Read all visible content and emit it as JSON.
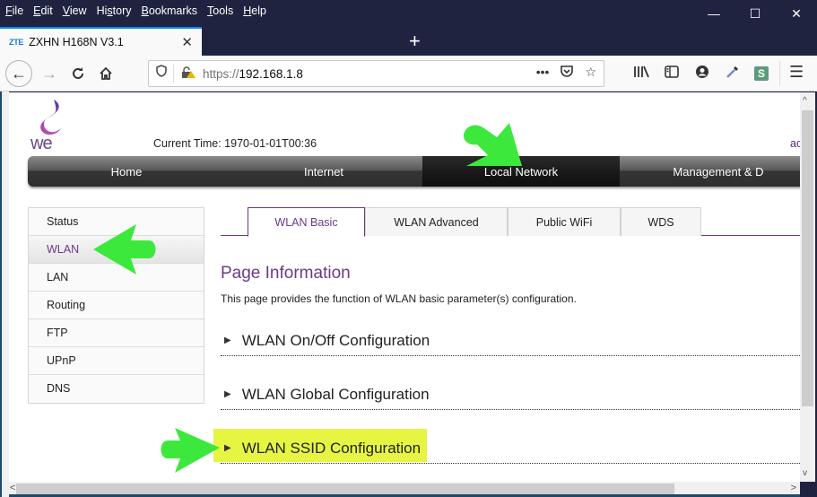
{
  "browser": {
    "menu": [
      "File",
      "Edit",
      "View",
      "History",
      "Bookmarks",
      "Tools",
      "Help"
    ],
    "menu_accel": [
      "F",
      "E",
      "V",
      "s",
      "B",
      "T",
      "H"
    ],
    "window_controls": {
      "minimize": "—",
      "maximize": "☐",
      "close": "✕"
    },
    "tab": {
      "favicon": "ZTE",
      "title": "ZXHN H168N V3.1",
      "close": "✕"
    },
    "new_tab": "+",
    "url": {
      "scheme": "https://",
      "host": "192.168.1.8"
    },
    "url_actions": {
      "more": "•••",
      "pocket": "◡",
      "bookmark": "☆"
    },
    "toolbar_icons": {
      "library": "|||\\",
      "sidebar": "▯",
      "account": "●",
      "eyedropper": "✎",
      "extension": "S",
      "menu": "☰"
    },
    "nav": {
      "back": "←",
      "forward": "→",
      "reload": "C",
      "home": "⌂"
    }
  },
  "header": {
    "logo_text": "we",
    "current_time_label": "Current Time: 1970-01-01T00:36",
    "user_link": "ac"
  },
  "main_nav": {
    "items": [
      "Home",
      "Internet",
      "Local Network",
      "Management & D"
    ],
    "active": "Local Network"
  },
  "side_menu": {
    "items": [
      "Status",
      "WLAN",
      "LAN",
      "Routing",
      "FTP",
      "UPnP",
      "DNS"
    ],
    "active": "WLAN"
  },
  "sub_tabs": {
    "items": [
      "WLAN Basic",
      "WLAN Advanced",
      "Public WiFi",
      "WDS"
    ],
    "active": "WLAN Basic"
  },
  "page": {
    "title": "Page Information",
    "description": "This page provides the function of WLAN basic parameter(s) configuration.",
    "sections": [
      {
        "label": "WLAN On/Off Configuration",
        "expand_icon": "▶"
      },
      {
        "label": "WLAN Global Configuration",
        "expand_icon": "▶"
      },
      {
        "label": "WLAN SSID Configuration",
        "expand_icon": "▶",
        "highlighted": true
      }
    ]
  },
  "annotations": {
    "arrow_color": "#3de83d",
    "highlight_color": "#e6f542"
  },
  "scrollbars": {
    "up": "^",
    "down": "v",
    "left": "<",
    "right": ">"
  }
}
